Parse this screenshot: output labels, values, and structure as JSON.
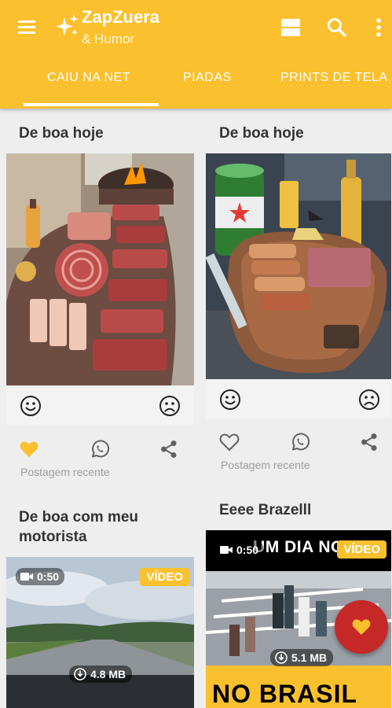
{
  "app": {
    "title": "ZapZuera",
    "subtitle": "& Humor"
  },
  "toolbar_icons": [
    "menu-icon",
    "sparkle-icon",
    "view-toggle-icon",
    "search-icon",
    "more-vertical-icon"
  ],
  "tabs": [
    {
      "label": "CAIU NA NET",
      "selected": true
    },
    {
      "label": "PIADAS",
      "selected": false
    },
    {
      "label": "PRINTS DE TELA",
      "selected": false
    }
  ],
  "posts": [
    {
      "title": "De boa hoje",
      "media": "photo",
      "reactions": [
        "smile-icon",
        "sad-icon"
      ],
      "actions": [
        "heart-icon",
        "whatsapp-icon",
        "share-icon"
      ],
      "liked": true,
      "meta": "Postagem recente"
    },
    {
      "title": "De boa hoje",
      "media": "photo",
      "reactions": [
        "smile-icon",
        "sad-icon"
      ],
      "actions": [
        "heart-outline-icon",
        "whatsapp-icon",
        "share-icon"
      ],
      "liked": false,
      "meta": "Postagem recente"
    },
    {
      "title": "De boa com meu motorista",
      "media": "video",
      "duration": "0:50",
      "badge": "VÍDEO",
      "size": "4.8 MB"
    },
    {
      "title": "Eeee Brazelll",
      "media": "video",
      "duration": "0:50",
      "badge": "VÍDEO",
      "size": "5.1 MB",
      "caption_top": "UM DIA NO",
      "caption_bottom": "NO BRASIL"
    }
  ],
  "fab": {
    "icon": "heart-icon"
  },
  "colors": {
    "accent": "#fbc02d",
    "background": "#eeeeee",
    "fab": "#c62828",
    "liked_heart": "#fbc02d",
    "icon_gray": "#616161",
    "meta_text": "#9e9e9e"
  }
}
